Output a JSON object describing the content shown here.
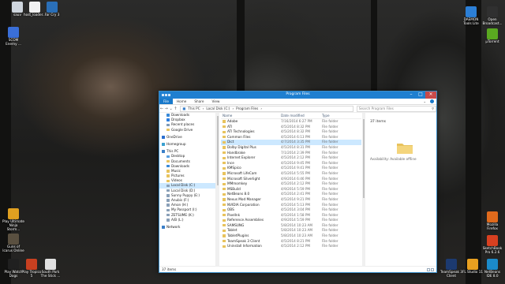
{
  "desktop": {
    "icons_left": [
      {
        "label": "sauv",
        "color": "#cfd6de"
      },
      {
        "label": "host_loader...",
        "color": "#f2f2f2"
      },
      {
        "label": "Far Cry 3",
        "color": "#2a6fb8"
      },
      {
        "label": "SCOM Enemy ...",
        "color": "#3a6fd8"
      },
      {
        "label": "Play Ultimate Ninja Storm...",
        "color": "#e0a020"
      },
      {
        "label": "Guns of Icarus Online",
        "color": "#5a5040"
      },
      {
        "label": "Play Watch Dogs",
        "color": "#202020"
      },
      {
        "label": "Play Tropico 5",
        "color": "#c84020"
      },
      {
        "label": "South Park The Stick ...",
        "color": "#e0e0e0"
      }
    ],
    "icons_right": [
      {
        "label": "DAEMON Tools Lite",
        "color": "#2c7fd6"
      },
      {
        "label": "Open Broadcast...",
        "color": "#303030"
      },
      {
        "label": "µTorrent",
        "color": "#5aa820"
      },
      {
        "label": "Mozilla Firefox",
        "color": "#e06a1c"
      },
      {
        "label": "SketchBook Pro 6.2.6",
        "color": "#d84020"
      },
      {
        "label": "NetBeans IDE 8.0",
        "color": "#1b8ac9"
      },
      {
        "label": "FL Studio 11",
        "color": "#e8a020"
      },
      {
        "label": "TeamSpeak 3 Client",
        "color": "#1c3a70"
      }
    ]
  },
  "window": {
    "title": "Program Files",
    "ribbon_tabs": [
      "File",
      "Home",
      "Share",
      "View"
    ],
    "breadcrumb": [
      "This PC",
      "›",
      "Local Disk (C:)",
      "›",
      "Program Files",
      "›"
    ],
    "search_placeholder": "Search Program Files",
    "status": "37 items",
    "accent": "#1f7fd0"
  },
  "navpane": {
    "groups": [
      [
        {
          "label": "Downloads",
          "icon": "downloads-icon",
          "color": "#3a8ad8"
        },
        {
          "label": "Dropbox",
          "icon": "dropbox-icon",
          "color": "#2d7fe0"
        },
        {
          "label": "Recent places",
          "icon": "recent-icon",
          "color": "#7e9ab8"
        },
        {
          "label": "Google Drive",
          "icon": "drive-icon",
          "color": "#e8c35d"
        }
      ],
      [
        {
          "label": "OneDrive",
          "icon": "onedrive-icon",
          "color": "#2a6fd0"
        }
      ],
      [
        {
          "label": "Homegroup",
          "icon": "homegroup-icon",
          "color": "#3aa0d0"
        }
      ],
      [
        {
          "label": "This PC",
          "icon": "pc-icon",
          "color": "#3a7fc8"
        },
        {
          "label": "Desktop",
          "icon": "desktop-icon",
          "color": "#5aa0e0"
        },
        {
          "label": "Documents",
          "icon": "documents-icon",
          "color": "#e8c35d"
        },
        {
          "label": "Downloads",
          "icon": "downloads-icon",
          "color": "#3a8ad8"
        },
        {
          "label": "Music",
          "icon": "music-icon",
          "color": "#e8c35d"
        },
        {
          "label": "Pictures",
          "icon": "pictures-icon",
          "color": "#e8c35d"
        },
        {
          "label": "Videos",
          "icon": "videos-icon",
          "color": "#e8c35d"
        },
        {
          "label": "Local Disk (C:)",
          "icon": "drive-c-icon",
          "color": "#8aa0b8",
          "selected": true
        },
        {
          "label": "Local Disk (D:)",
          "icon": "drive-icon",
          "color": "#8aa0b8"
        },
        {
          "label": "Sunny Puppy (E:)",
          "icon": "drive-icon",
          "color": "#8aa0b8"
        },
        {
          "label": "Anubis (F:)",
          "icon": "drive-icon",
          "color": "#8aa0b8"
        },
        {
          "label": "Amon (H:)",
          "icon": "drive-icon",
          "color": "#8aa0b8"
        },
        {
          "label": "My Passport (I:)",
          "icon": "drive-icon",
          "color": "#8aa0b8"
        },
        {
          "label": "ZETSUME (K:)",
          "icon": "drive-icon",
          "color": "#8aa0b8"
        },
        {
          "label": "A/B (L:)",
          "icon": "drive-icon",
          "color": "#8aa0b8"
        }
      ],
      [
        {
          "label": "Network",
          "icon": "network-icon",
          "color": "#3a7fc8"
        }
      ]
    ]
  },
  "files": {
    "columns": [
      "Name",
      "Date modified",
      "Type"
    ],
    "rows": [
      {
        "name": "Adobe",
        "date": "7/16/2014 6:27 PM",
        "type": "File folder"
      },
      {
        "name": "ATI",
        "date": "4/5/2014 8:32 PM",
        "type": "File folder"
      },
      {
        "name": "ATI Technologies",
        "date": "4/5/2014 8:32 PM",
        "type": "File folder"
      },
      {
        "name": "Common Files",
        "date": "4/5/2014 6:13 PM",
        "type": "File folder"
      },
      {
        "name": "Dict",
        "date": "4/7/2014 3:35 PM",
        "type": "File folder",
        "selected": true
      },
      {
        "name": "Dolby Digital Plus",
        "date": "4/5/2014 8:31 PM",
        "type": "File folder"
      },
      {
        "name": "Handbrake",
        "date": "7/1/2014 2:39 PM",
        "type": "File folder"
      },
      {
        "name": "Internet Explorer",
        "date": "4/5/2014 2:12 PM",
        "type": "File folder"
      },
      {
        "name": "Ince",
        "date": "4/5/2014 9:45 PM",
        "type": "File folder"
      },
      {
        "name": "KMSpico",
        "date": "4/5/2014 9:41 PM",
        "type": "File folder"
      },
      {
        "name": "Microsoft LifeCam",
        "date": "4/5/2014 5:55 PM",
        "type": "File folder"
      },
      {
        "name": "Microsoft Silverlight",
        "date": "4/9/2014 6:46 PM",
        "type": "File folder"
      },
      {
        "name": "MMmomkey",
        "date": "4/5/2014 2:12 PM",
        "type": "File folder"
      },
      {
        "name": "MSBuild",
        "date": "4/9/2014 5:59 PM",
        "type": "File folder"
      },
      {
        "name": "NetBeans 8.0",
        "date": "4/5/2014 2:41 PM",
        "type": "File folder"
      },
      {
        "name": "Nexus Mod Manager",
        "date": "4/5/2014 9:21 PM",
        "type": "File folder"
      },
      {
        "name": "NVIDIA Corporation",
        "date": "4/5/2014 5:13 PM",
        "type": "File folder"
      },
      {
        "name": "OBS",
        "date": "4/5/2014 3:04 PM",
        "type": "File folder"
      },
      {
        "name": "PixelInk",
        "date": "4/5/2014 1:58 PM",
        "type": "File folder"
      },
      {
        "name": "Reference Assemblies",
        "date": "4/9/2014 5:59 PM",
        "type": "File folder"
      },
      {
        "name": "SAMSUNG",
        "date": "5/8/2014 10:23 AM",
        "type": "File folder"
      },
      {
        "name": "Tablet",
        "date": "5/8/2014 10:23 AM",
        "type": "File folder"
      },
      {
        "name": "TabletPlugins",
        "date": "5/8/2014 10:23 AM",
        "type": "File folder"
      },
      {
        "name": "TeamSpeak 3 Client",
        "date": "4/5/2014 8:21 PM",
        "type": "File folder"
      },
      {
        "name": "Uninstall Information",
        "date": "4/5/2014 2:12 PM",
        "type": "File folder"
      }
    ]
  },
  "preview": {
    "count": "37 items",
    "availability": "Availability:  Available offline"
  }
}
